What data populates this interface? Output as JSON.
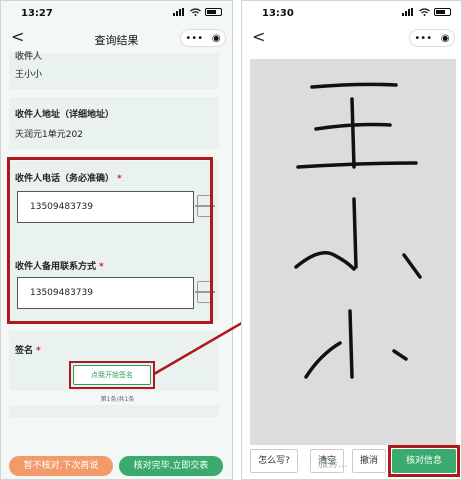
{
  "left_screen": {
    "status_time": "13:27",
    "nav_title": "查询结果",
    "back_icon": "<",
    "menu_icon": "•••",
    "record_icon": "◉",
    "partial_label": "收件人",
    "recipient_name": "王小小",
    "address_label": "收件人地址（详细地址）",
    "address_value": "天润元1单元202",
    "phone_label": "收件人电话（务必准确）",
    "phone_value": "13509483739",
    "alt_phone_label": "收件人备用联系方式",
    "alt_phone_value": "13509483739",
    "required_mark": "*",
    "sign_label": "签名",
    "sign_button": "点我开始签名",
    "pager": "第1条/共1条",
    "btn_skip": "暂不核对,下次再说",
    "btn_confirm": "核对完毕,立即交表",
    "colors": {
      "accent_green": "#3aaa6e",
      "skip_orange": "#f29a6a",
      "highlight": "#b01820",
      "star_red": "#d6201f"
    }
  },
  "right_screen": {
    "status_time": "13:30",
    "back_icon": "<",
    "menu_icon": "•••",
    "record_icon": "◉",
    "btn_how": "怎么写?",
    "btn_clear": "清空",
    "btn_undo": "撤消",
    "btn_confirm": "核对信息",
    "signature_text": "王小小"
  },
  "watermark": "服务..."
}
